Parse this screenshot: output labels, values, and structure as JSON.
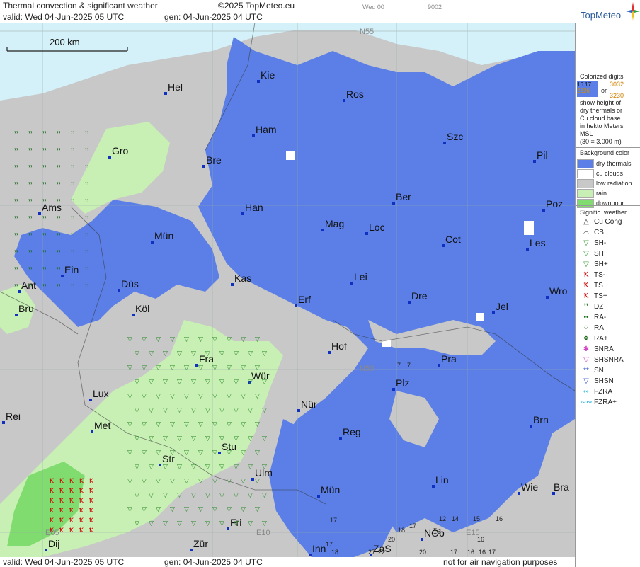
{
  "header": {
    "title": "Thermal convection & significant weather",
    "copyright": "©2025 TopMeteo.eu",
    "valid": "valid:  Wed  04-Jun-2025  05 UTC",
    "gen": "gen: 04-Jun-2025 04 UTC",
    "faint1": "Wed 00",
    "faint2": "9002",
    "logo": "TopMeteo"
  },
  "footer": {
    "valid": "valid:  Wed  04-Jun-2025  05 UTC",
    "gen": "gen: 04-Jun-2025 04 UTC",
    "note": "not for air navigation purposes"
  },
  "scale": {
    "label": "200 km"
  },
  "grid_labels": [
    "N55",
    "N50",
    "E05",
    "E10",
    "E15"
  ],
  "cities": [
    {
      "name": "Kie"
    },
    {
      "name": "Hel"
    },
    {
      "name": "Ros"
    },
    {
      "name": "Ham"
    },
    {
      "name": "Szc"
    },
    {
      "name": "Gro"
    },
    {
      "name": "Bre"
    },
    {
      "name": "Pil"
    },
    {
      "name": "Ber"
    },
    {
      "name": "Ams"
    },
    {
      "name": "Han"
    },
    {
      "name": "Poz"
    },
    {
      "name": "Mag"
    },
    {
      "name": "Loc"
    },
    {
      "name": "Mün"
    },
    {
      "name": "Cot"
    },
    {
      "name": "Les"
    },
    {
      "name": "Ein"
    },
    {
      "name": "Kas"
    },
    {
      "name": "Lei"
    },
    {
      "name": "Ant"
    },
    {
      "name": "Düs"
    },
    {
      "name": "Dre"
    },
    {
      "name": "Wro"
    },
    {
      "name": "Bru"
    },
    {
      "name": "Köl"
    },
    {
      "name": "Erf"
    },
    {
      "name": "Jel"
    },
    {
      "name": "Hof"
    },
    {
      "name": "Fra"
    },
    {
      "name": "Pra"
    },
    {
      "name": "Wür"
    },
    {
      "name": "Lux"
    },
    {
      "name": "Plz"
    },
    {
      "name": "Rei"
    },
    {
      "name": "Nür"
    },
    {
      "name": "Met"
    },
    {
      "name": "Reg"
    },
    {
      "name": "Brn"
    },
    {
      "name": "Stu"
    },
    {
      "name": "Str"
    },
    {
      "name": "Ulm"
    },
    {
      "name": "Lin"
    },
    {
      "name": "Wie"
    },
    {
      "name": "Bra"
    },
    {
      "name": "Mün"
    },
    {
      "name": "Fri"
    },
    {
      "name": "NÖb"
    },
    {
      "name": "Dij"
    },
    {
      "name": "Zür"
    },
    {
      "name": "Inn"
    },
    {
      "name": "ZaS"
    }
  ],
  "digits": [
    "7",
    "7",
    "17",
    "18",
    "17",
    "16",
    "12",
    "14",
    "15",
    "16",
    "17",
    "16",
    "16",
    "20",
    "20",
    "17",
    "18",
    "16",
    "17",
    "27",
    "22"
  ],
  "legend": {
    "colorized_title": "Colorized digits",
    "sample_a1": "16 17",
    "sample_a2": "3032",
    "or": "or",
    "sample_b1": "2826",
    "sample_b2": "3230",
    "desc": [
      "show height of",
      "dry thermals or",
      "Cu cloud base",
      "in hekto Meters",
      "MSL",
      "(30 = 3.000 m)"
    ],
    "bg_title": "Background color",
    "bg_items": [
      {
        "label": "dry thermals",
        "color": "#5b7fe6"
      },
      {
        "label": "cu clouds",
        "color": "#ffffff"
      },
      {
        "label": "low radiation",
        "color": "#c8c8c8"
      },
      {
        "label": "rain",
        "color": "#c8f0b4"
      },
      {
        "label": "downpour",
        "color": "#80dc6e"
      }
    ],
    "wx_title": "Signific. weather",
    "wx_items": [
      {
        "label": "Cu Cong",
        "symbol": "△",
        "color": "#222"
      },
      {
        "label": "CB",
        "symbol": "⌓",
        "color": "#222"
      },
      {
        "label": "SH-",
        "symbol": "▽",
        "color": "#2a9a2a"
      },
      {
        "label": "SH",
        "symbol": "▽",
        "color": "#2a9a2a"
      },
      {
        "label": "SH+",
        "symbol": "▽",
        "color": "#2a9a2a"
      },
      {
        "label": "TS-",
        "symbol": "Ꝁ",
        "color": "#c00"
      },
      {
        "label": "TS",
        "symbol": "Ꝁ",
        "color": "#c00"
      },
      {
        "label": "TS+",
        "symbol": "Ꝁ",
        "color": "#c00"
      },
      {
        "label": "DZ",
        "symbol": "❜❜",
        "color": "#1a6a1a"
      },
      {
        "label": "RA-",
        "symbol": "••",
        "color": "#1a6a1a"
      },
      {
        "label": "RA",
        "symbol": "⁘",
        "color": "#1a6a1a"
      },
      {
        "label": "RA+",
        "symbol": "❖",
        "color": "#1a6a1a"
      },
      {
        "label": "SNRA",
        "symbol": "✱",
        "color": "#d040c0"
      },
      {
        "label": "SHSNRA",
        "symbol": "▽",
        "color": "#d040c0"
      },
      {
        "label": "SN",
        "symbol": "**",
        "color": "#3050d0"
      },
      {
        "label": "SHSN",
        "symbol": "▽",
        "color": "#3050d0"
      },
      {
        "label": "FZRA",
        "symbol": "∾",
        "color": "#20b0e0"
      },
      {
        "label": "FZRA+",
        "symbol": "∾∾",
        "color": "#20b0e0"
      }
    ]
  }
}
